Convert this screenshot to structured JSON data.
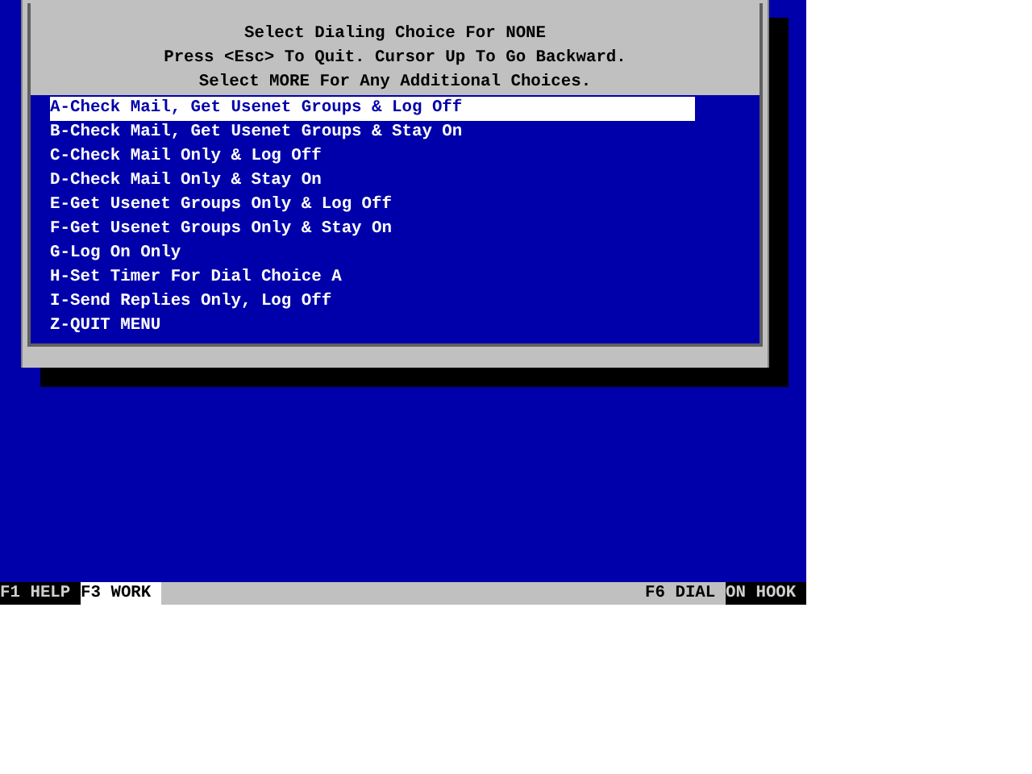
{
  "dialog": {
    "header_lines": [
      "Select Dialing Choice For NONE",
      "Press <Esc> To Quit. Cursor Up To Go Backward.",
      "Select MORE For Any Additional Choices."
    ],
    "items": [
      {
        "label": "A-Check Mail, Get Usenet Groups & Log Off",
        "selected": true
      },
      {
        "label": "B-Check Mail, Get Usenet Groups & Stay On",
        "selected": false
      },
      {
        "label": "C-Check Mail Only & Log Off",
        "selected": false
      },
      {
        "label": "D-Check Mail Only & Stay On",
        "selected": false
      },
      {
        "label": "E-Get Usenet Groups Only & Log Off",
        "selected": false
      },
      {
        "label": "F-Get Usenet Groups Only & Stay On",
        "selected": false
      },
      {
        "label": "G-Log On Only",
        "selected": false
      },
      {
        "label": "H-Set Timer For Dial Choice A",
        "selected": false
      },
      {
        "label": "I-Send Replies Only, Log Off",
        "selected": false
      },
      {
        "label": "Z-QUIT MENU",
        "selected": false
      }
    ]
  },
  "status_bar": {
    "left": [
      {
        "label": "F1 HELP",
        "kind": "inverse"
      },
      {
        "label": "F3 WORK",
        "kind": "highlight"
      }
    ],
    "right": [
      {
        "label": "F6 DIAL",
        "kind": "plain"
      },
      {
        "label": "ON HOOK",
        "kind": "inverse"
      }
    ]
  }
}
